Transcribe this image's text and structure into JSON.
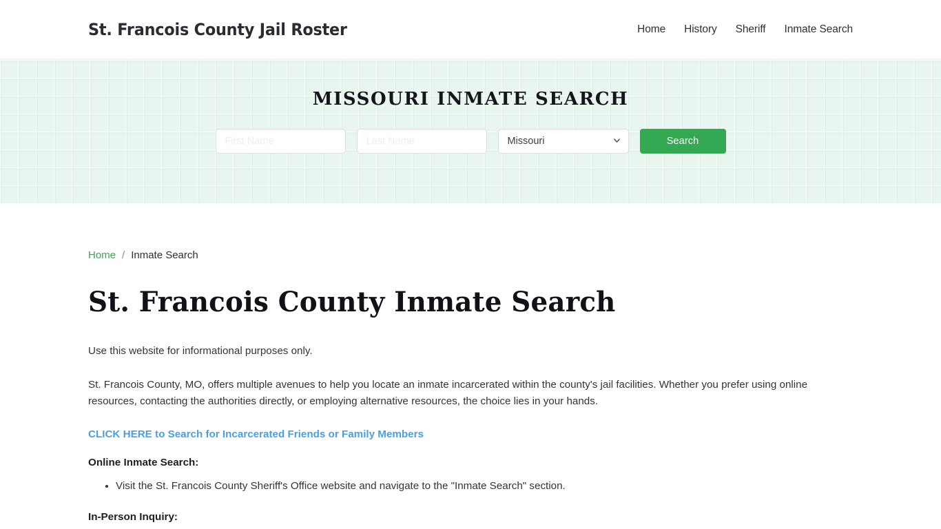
{
  "header": {
    "brand": "St. Francois County Jail Roster",
    "nav": [
      {
        "label": "Home"
      },
      {
        "label": "History"
      },
      {
        "label": "Sheriff"
      },
      {
        "label": "Inmate Search"
      }
    ]
  },
  "hero": {
    "title": "MISSOURI INMATE SEARCH",
    "background_color": "#e9f6ef",
    "form": {
      "first_name_value": "",
      "first_name_placeholder": "First Name",
      "last_name_value": "",
      "last_name_placeholder": "Last Name",
      "state_selected": "Missouri",
      "state_options": [
        "Missouri"
      ],
      "search_label": "Search",
      "search_button_color": "#34a853"
    }
  },
  "breadcrumb": {
    "home_label": "Home",
    "separator": "/",
    "current_label": "Inmate Search",
    "link_color": "#3f9e5f"
  },
  "main": {
    "page_title": "St. Francois County Inmate Search",
    "intro": "Use this website for informational purposes only.",
    "paragraph": "St. Francois County, MO, offers multiple avenues to help you locate an inmate incarcerated within the county's jail facilities. Whether you prefer using online resources, contacting the authorities directly, or employing alternative resources, the choice lies in your hands.",
    "cta_link": "CLICK HERE to Search for Incarcerated Friends or Family Members",
    "cta_link_color": "#4f9ed6",
    "online_label": "Online Inmate Search:",
    "online_items": [
      "Visit the St. Francois County Sheriff's Office website and navigate to the \"Inmate Search\" section."
    ],
    "inperson_label": "In-Person Inquiry:"
  }
}
